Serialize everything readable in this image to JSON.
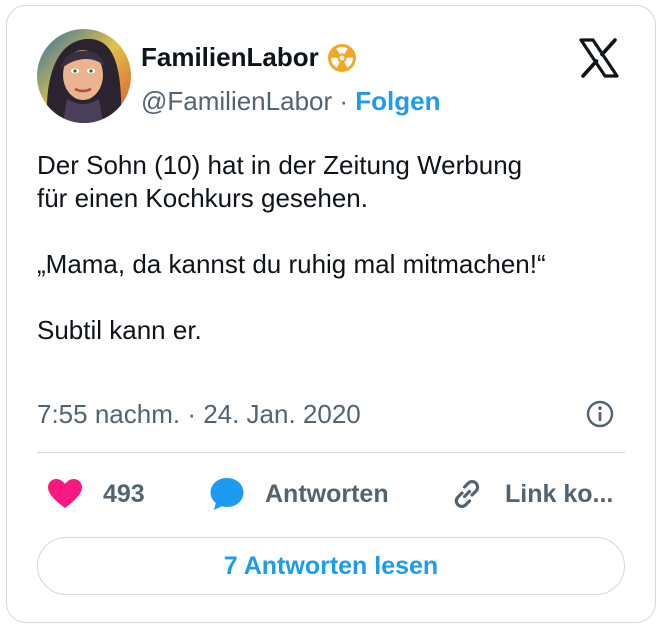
{
  "author": {
    "name": "FamilienLabor",
    "handle": "@FamilienLabor",
    "separator": " · ",
    "follow_label": "Folgen"
  },
  "icons": {
    "avatar": "profile-picture",
    "badge": "radioactive-badge-icon",
    "platform": "x-logo-icon",
    "info": "info-icon",
    "like": "heart-icon",
    "reply": "speech-bubble-icon",
    "link": "link-icon"
  },
  "tweet": {
    "text": "Der Sohn (10) hat in der Zeitung Werbung\nfür einen Kochkurs gesehen.\n\n„Mama, da kannst du ruhig mal mitmachen!“\n\nSubtil kann er.",
    "timestamp": "7:55 nachm. · 24. Jan. 2020"
  },
  "actions": {
    "likes": "493",
    "reply_label": "Antworten",
    "link_label": "Link ko..."
  },
  "read_replies_label": "7 Antworten lesen",
  "colors": {
    "accent": "#1d9bf0",
    "like": "#f91880",
    "text": "#0f1419",
    "secondary": "#536471",
    "border": "#cfd9de",
    "badge": "#f5a623"
  }
}
